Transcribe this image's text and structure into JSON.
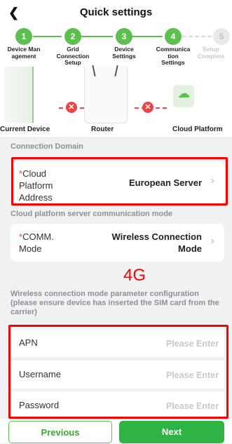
{
  "header": {
    "back_icon": "chevron-left-icon",
    "title": "Quick settings"
  },
  "steps": [
    {
      "number": "1",
      "label_lines": [
        "Device Man",
        "agement"
      ],
      "state": "done"
    },
    {
      "number": "2",
      "label_lines": [
        "Grid",
        "Connection",
        "Setup"
      ],
      "state": "done"
    },
    {
      "number": "3",
      "label_lines": [
        "Device",
        "Settings"
      ],
      "state": "done"
    },
    {
      "number": "4",
      "label_lines": [
        "Communica",
        "tion",
        "Settings"
      ],
      "state": "active"
    },
    {
      "number": "5",
      "label_lines": [
        "Setup",
        "Complete"
      ],
      "state": "pending"
    }
  ],
  "diagram": {
    "current_device": "Current Device",
    "router": "Router",
    "cloud_platform": "Cloud Platform",
    "error_icon": "x-error-icon"
  },
  "connection_domain": {
    "section_title": "Connection Domain",
    "required_mark": "*",
    "label_lines": [
      "Cloud",
      "Platform",
      "Address"
    ],
    "value": "European Server"
  },
  "comm_mode": {
    "section_title": "Cloud platform server communication mode",
    "required_mark": "*",
    "label_lines": [
      "COMM.",
      "Mode"
    ],
    "value_lines": [
      "Wireless Connection",
      "Mode"
    ]
  },
  "annotation": "4G",
  "wireless_config": {
    "description": "Wireless connection mode parameter configuration (please ensure device has inserted the SIM card from the carrier)",
    "fields": [
      {
        "label": "APN",
        "placeholder": "Please Enter",
        "value": ""
      },
      {
        "label": "Username",
        "placeholder": "Please Enter",
        "value": ""
      },
      {
        "label": "Password",
        "placeholder": "Please Enter",
        "value": ""
      }
    ]
  },
  "buttons": {
    "previous": "Previous",
    "next": "Next"
  },
  "colors": {
    "accent": "#5cbf4f",
    "next_button": "#2fb344",
    "error": "#ef4444",
    "highlight": "#ff0000",
    "muted": "#8d9196"
  }
}
